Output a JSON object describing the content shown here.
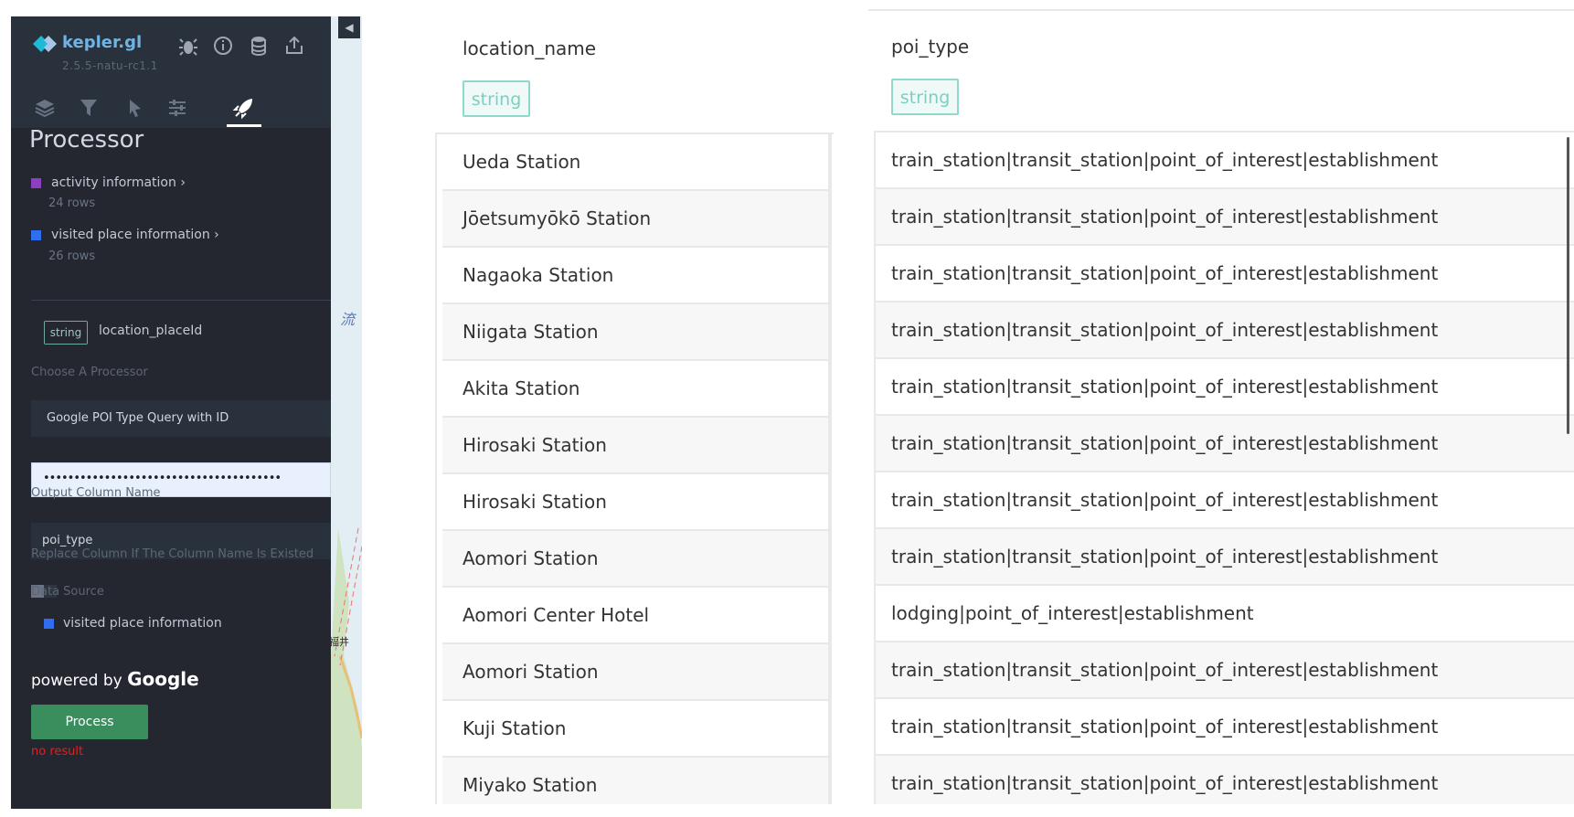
{
  "app": {
    "name": "kepler.gl",
    "version": "2.5.5-natu-rc1.1",
    "header_icons": [
      "bug-icon",
      "info-icon",
      "database-icon",
      "share-icon"
    ],
    "tabs": [
      "layers-tab",
      "filters-tab",
      "interactions-tab",
      "map-style-tab",
      "processor-tab"
    ],
    "active_tab": "processor-tab"
  },
  "processor": {
    "title": "Processor",
    "datasets": [
      {
        "name": "activity information",
        "rows": "24 rows",
        "color": "#8e3fc1"
      },
      {
        "name": "visited place information",
        "rows": "26 rows",
        "color": "#2f6ef0"
      }
    ],
    "field": {
      "type": "string",
      "name": "location_placeId"
    },
    "choose_label": "Choose A Processor",
    "processor_value": "Google POI Type Query with ID",
    "api_key_masked": "•••••••••••••••••••••••••••••••••••••••",
    "output_label": "Output Column Name",
    "output_value": "poi_type",
    "replace_label": "Replace Column If The Column Name Is Existed",
    "data_source_label": "Data Source",
    "data_source_value": "visited place information",
    "data_source_color": "#2f6ef0",
    "powered_prefix": "powered by",
    "powered_brand": "Google",
    "process_label": "Process",
    "result_text": "no result"
  },
  "map": {
    "labels": [
      "流",
      "福井"
    ]
  },
  "table_left": {
    "column": "location_name",
    "type": "string",
    "rows": [
      "Ueda Station",
      "Jōetsumyōkō Station",
      "Nagaoka Station",
      "Niigata Station",
      "Akita Station",
      "Hirosaki Station",
      "Hirosaki Station",
      "Aomori Station",
      "Aomori Center Hotel",
      "Aomori Station",
      "Kuji Station",
      "Miyako Station"
    ]
  },
  "table_right": {
    "column": "poi_type",
    "type": "string",
    "rows": [
      "train_station|transit_station|point_of_interest|establishment",
      "train_station|transit_station|point_of_interest|establishment",
      "train_station|transit_station|point_of_interest|establishment",
      "train_station|transit_station|point_of_interest|establishment",
      "train_station|transit_station|point_of_interest|establishment",
      "train_station|transit_station|point_of_interest|establishment",
      "train_station|transit_station|point_of_interest|establishment",
      "train_station|transit_station|point_of_interest|establishment",
      "lodging|point_of_interest|establishment",
      "train_station|transit_station|point_of_interest|establishment",
      "train_station|transit_station|point_of_interest|establishment",
      "train_station|transit_station|point_of_interest|establishment"
    ]
  }
}
